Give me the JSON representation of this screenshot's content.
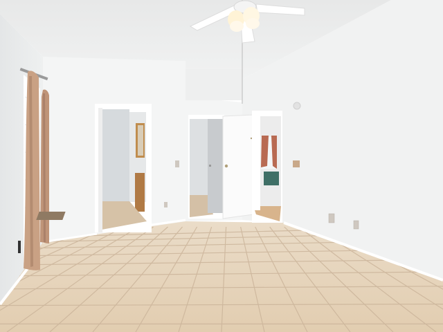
{
  "colors": {
    "ceiling": "#eceded",
    "ceiling_shadow": "#dcdedf",
    "wall_left": "#e9ebec",
    "wall_back": "#f3f4f4",
    "wall_right": "#f0f1f1",
    "wall_far_right": "#f7f7f7",
    "floor_tile": "#e6d2b8",
    "grout": "#cbb49a",
    "baseboard": "#ffffff",
    "door": "#fbfbfb",
    "curtain": "#c9a184",
    "curtain_shadow": "#a57e64",
    "window_light": "#ffffff",
    "vanity_wood": "#b07a45",
    "mirror_frame": "#c08d4e",
    "hall_floor": "#d8b48c",
    "far_curtain": "#b86a52",
    "sofa": "#3f6f66",
    "fan_blade": "#ffffff",
    "fan_light": "#fff3d6"
  }
}
